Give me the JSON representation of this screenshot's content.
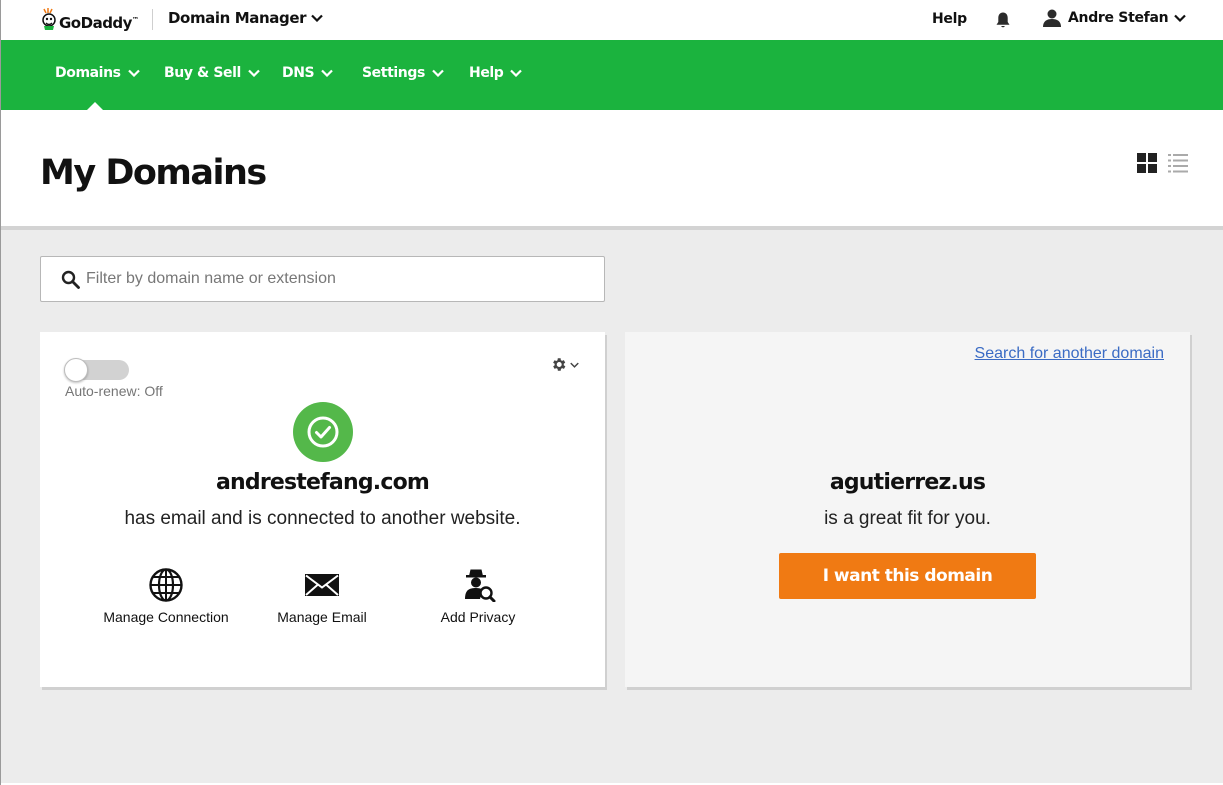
{
  "header": {
    "logo_text": "GoDaddy",
    "logo_tm": "™",
    "app_title": "Domain Manager",
    "help_label": "Help",
    "user_name": "Andre Stefan"
  },
  "nav": {
    "items": [
      {
        "label": "Domains"
      },
      {
        "label": "Buy & Sell"
      },
      {
        "label": "DNS"
      },
      {
        "label": "Settings"
      },
      {
        "label": "Help"
      }
    ],
    "active": "Domains"
  },
  "page": {
    "title": "My Domains",
    "view_modes": [
      "grid",
      "list"
    ],
    "active_view": "grid"
  },
  "search": {
    "placeholder": "Filter by domain name or extension",
    "value": ""
  },
  "owned_domain": {
    "auto_renew_label": "Auto-renew: Off",
    "auto_renew_on": false,
    "name": "andrestefang.com",
    "status_text": "has email and is connected to another website.",
    "actions": [
      {
        "label": "Manage Connection",
        "icon": "globe-icon"
      },
      {
        "label": "Manage Email",
        "icon": "envelope-icon"
      },
      {
        "label": "Add Privacy",
        "icon": "privacy-agent-icon"
      }
    ]
  },
  "suggestion": {
    "search_link": "Search for another domain",
    "name": "agutierrez.us",
    "tagline": "is a great fit for you.",
    "cta_label": "I want this domain"
  },
  "colors": {
    "nav_green": "#1bb33e",
    "status_green": "#54b84a",
    "cta_orange": "#f07a13",
    "link_blue": "#3a6bc4",
    "content_bg": "#ececec"
  }
}
